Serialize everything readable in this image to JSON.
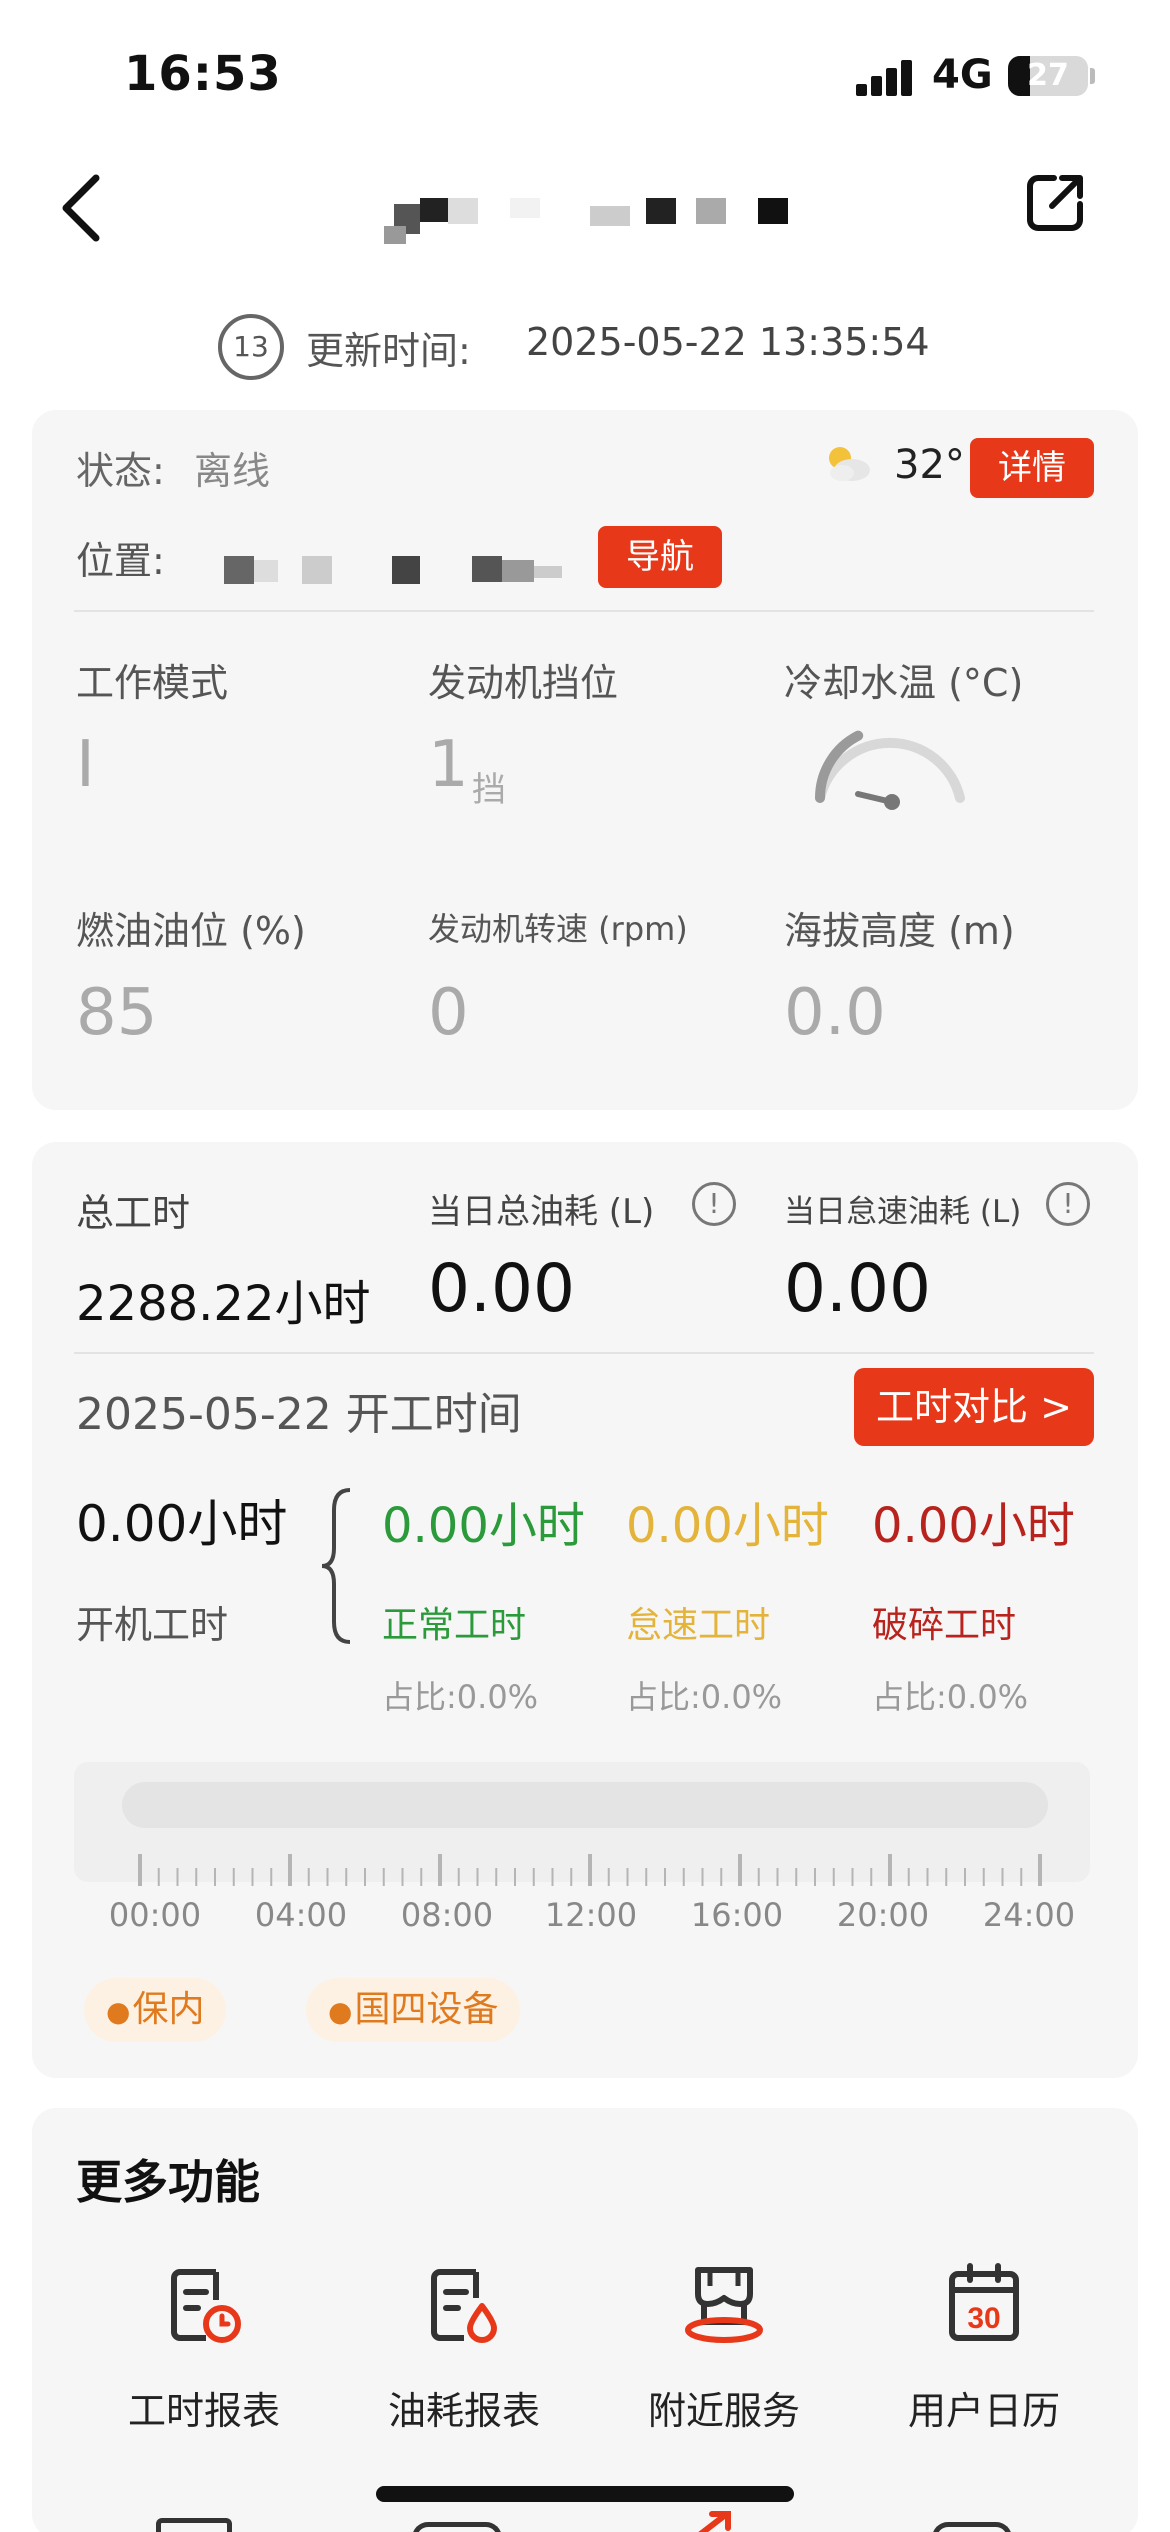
{
  "status_bar": {
    "time": "16:53",
    "network": "4G",
    "battery": "27",
    "battery_level": 0.27
  },
  "header": {
    "update_badge": "13",
    "update_label": "更新时间:",
    "update_time": "2025-05-22 13:35:54"
  },
  "overview": {
    "status_label": "状态:",
    "status_value": "离线",
    "weather_icon": "partly-cloudy-icon",
    "temperature": "32°",
    "details_button": "详情",
    "location_label": "位置:",
    "navigate_button": "导航",
    "metrics": [
      {
        "label": "工作模式",
        "value": "I",
        "unit": ""
      },
      {
        "label": "发动机挡位",
        "value": "1",
        "unit": "挡"
      },
      {
        "label": "冷却水温 (°C)",
        "value": "",
        "unit": ""
      },
      {
        "label": "燃油油位 (%)",
        "value": "85",
        "unit": ""
      },
      {
        "label": "发动机转速 (rpm)",
        "value": "0",
        "unit": ""
      },
      {
        "label": "海拔高度 (m)",
        "value": "0.0",
        "unit": ""
      }
    ],
    "water_temp_gauge_level": 0.35
  },
  "work": {
    "total_hours_label": "总工时",
    "total_hours_value": "2288.22小时",
    "daily_fuel_label": "当日总油耗 (L)",
    "daily_fuel_value": "0.00",
    "idle_fuel_label": "当日怠速油耗 (L)",
    "idle_fuel_value": "0.00",
    "day_title": "2025-05-22 开工时间",
    "compare_button": "工时对比 >",
    "machine_hours_value": "0.00小时",
    "machine_hours_label": "开机工时",
    "breakdown": [
      {
        "value": "0.00小时",
        "label": "正常工时",
        "ratio": "占比:0.0%",
        "color": "#2a9a3a"
      },
      {
        "value": "0.00小时",
        "label": "怠速工时",
        "ratio": "占比:0.0%",
        "color": "#e3b33a"
      },
      {
        "value": "0.00小时",
        "label": "破碎工时",
        "ratio": "占比:0.0%",
        "color": "#b8231d"
      }
    ],
    "timeline_labels": [
      "00:00",
      "04:00",
      "08:00",
      "12:00",
      "16:00",
      "20:00",
      "24:00"
    ],
    "tags": [
      "保内",
      "国四设备"
    ]
  },
  "more": {
    "title": "更多功能",
    "items": [
      {
        "label": "工时报表",
        "icon": "work-hours-report-icon"
      },
      {
        "label": "油耗报表",
        "icon": "fuel-report-icon"
      },
      {
        "label": "附近服务",
        "icon": "nearby-service-icon"
      },
      {
        "label": "用户日历",
        "icon": "calendar-icon",
        "icon_text": "30"
      }
    ]
  },
  "colors": {
    "accent": "#e8381a",
    "tag_bg": "#fdf1e3",
    "tag_text": "#e07a1f"
  }
}
